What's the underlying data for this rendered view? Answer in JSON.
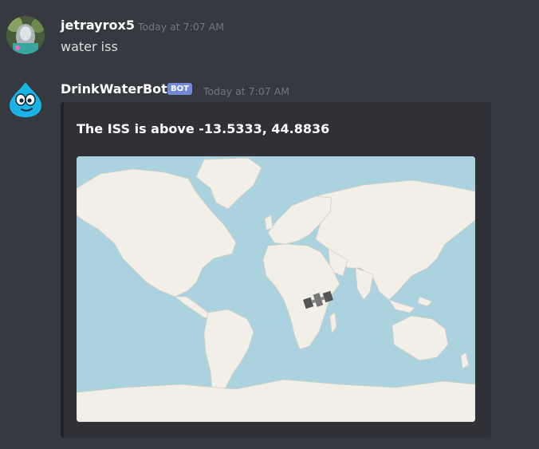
{
  "messages": [
    {
      "username": "jetrayrox5",
      "timestamp": "Today at 7:07 AM",
      "content": "water iss",
      "avatar_icon": "user-avatar-icon"
    },
    {
      "username": "DrinkWaterBot",
      "bot_tag": "BOT",
      "timestamp": "Today at 7:07 AM",
      "avatar_icon": "water-drop-avatar-icon",
      "embed": {
        "title": "The ISS is above -13.5333, 44.8836",
        "image_icon": "world-map-icon",
        "marker_icon": "iss-satellite-icon"
      }
    }
  ],
  "colors": {
    "background": "#36393f",
    "embed_background": "#2f3136",
    "embed_border": "#202225",
    "bot_tag": "#7289da",
    "username": "#ffffff",
    "timestamp": "#72767d",
    "ocean": "#aad3df",
    "land": "#f2efe9"
  }
}
